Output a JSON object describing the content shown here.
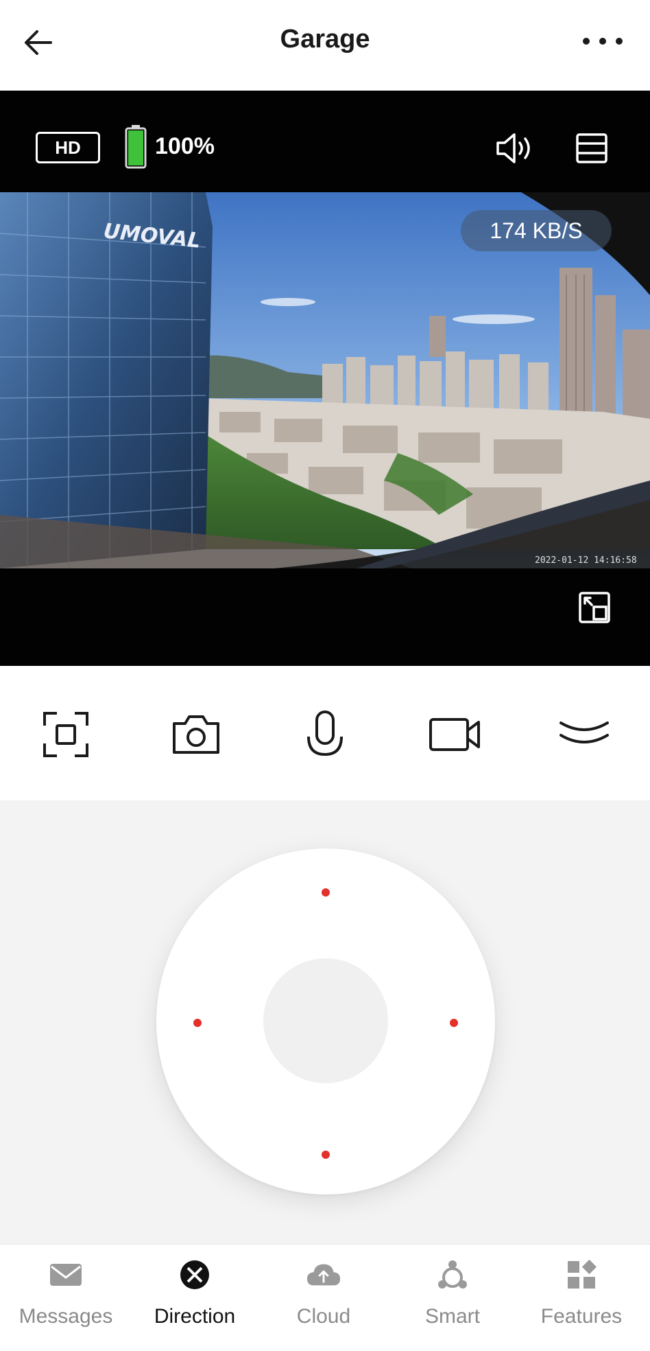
{
  "header": {
    "title": "Garage"
  },
  "video": {
    "quality_label": "HD",
    "battery_level": 100,
    "battery_text": "100%",
    "bitrate": "174 KB/S",
    "building_sign": "UMOVAL",
    "battery_color": "#3fc23a"
  },
  "controls": {
    "icons": [
      "fit-screen-icon",
      "camera-icon",
      "microphone-icon",
      "video-record-icon",
      "collapse-chevron-icon"
    ]
  },
  "ptz": {
    "indicator_color": "#e3302a"
  },
  "bottom_nav": {
    "items": [
      {
        "label": "Messages",
        "icon": "envelope-icon",
        "active": false
      },
      {
        "label": "Direction",
        "icon": "direction-icon",
        "active": true
      },
      {
        "label": "Cloud",
        "icon": "cloud-icon",
        "active": false
      },
      {
        "label": "Smart",
        "icon": "smart-icon",
        "active": false
      },
      {
        "label": "Features",
        "icon": "features-icon",
        "active": false
      }
    ]
  }
}
